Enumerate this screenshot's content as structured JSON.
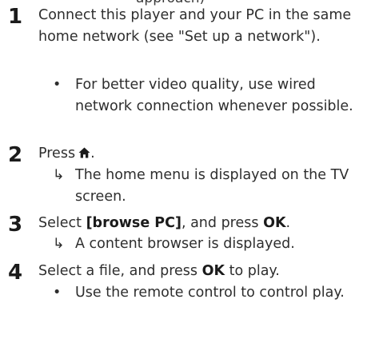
{
  "top_fragment": "approach)",
  "steps": [
    {
      "number": "1",
      "text": "Connect this player and your PC in the same home network (see \"Set up a network\").",
      "sub": {
        "marker": "•",
        "text": "For better video quality, use wired network connection whenever possible."
      }
    },
    {
      "number": "2",
      "text_before": "Press",
      "icon": "home-icon",
      "text_after": ".",
      "sub": {
        "marker": "↳",
        "text": "The home menu is displayed on the TV screen."
      }
    },
    {
      "number": "3",
      "text_before": "Select ",
      "bold_option": "[browse PC]",
      "text_middle": ", and press ",
      "bold_key": "OK",
      "text_after": ".",
      "sub": {
        "marker": "↳",
        "text": "A content browser is displayed."
      }
    },
    {
      "number": "4",
      "text_before": "Select a file, and press ",
      "bold_key": "OK",
      "text_after": " to play.",
      "sub": {
        "marker": "•",
        "text": "Use the remote control to control play."
      }
    }
  ]
}
